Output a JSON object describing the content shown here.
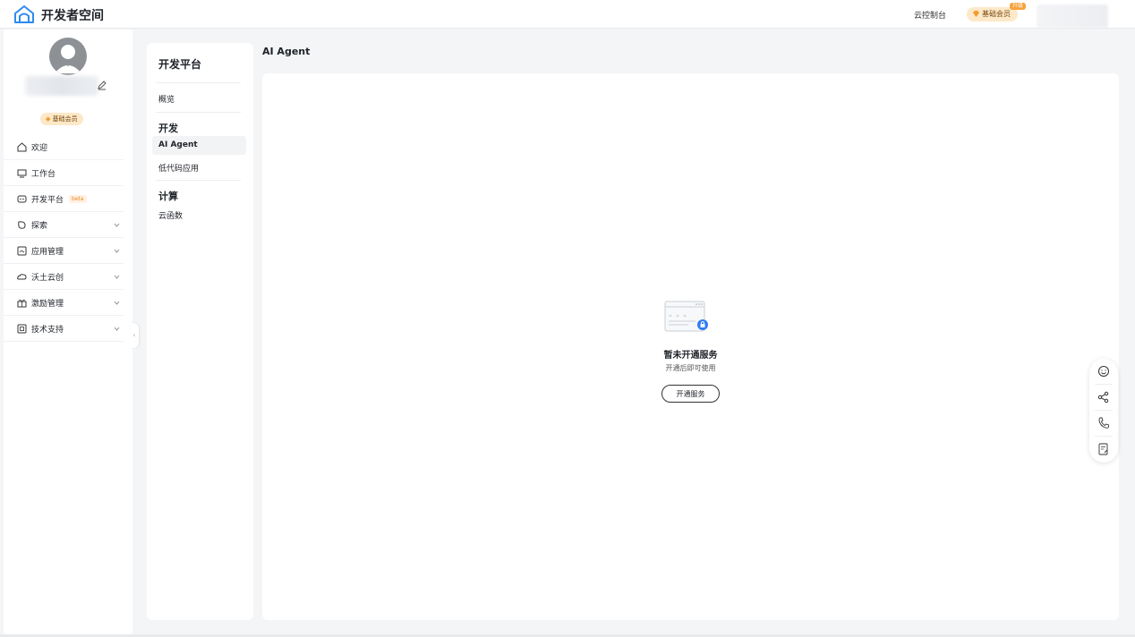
{
  "topbar": {
    "brand": "开发者空间",
    "console": "云控制台",
    "member": "基础会员",
    "upgrade": "升级"
  },
  "sidebar": {
    "member": "基础会员",
    "items": [
      {
        "label": "欢迎",
        "icon": "home-icon"
      },
      {
        "label": "工作台",
        "icon": "desktop-icon"
      },
      {
        "label": "开发平台",
        "icon": "robot-icon",
        "badge": "beta"
      },
      {
        "label": "探索",
        "icon": "explore-icon",
        "expandable": true
      },
      {
        "label": "应用管理",
        "icon": "app-icon",
        "expandable": true
      },
      {
        "label": "沃土云创",
        "icon": "cloud-icon",
        "expandable": true
      },
      {
        "label": "激励管理",
        "icon": "gift-icon",
        "expandable": true
      },
      {
        "label": "技术支持",
        "icon": "support-icon",
        "expandable": true
      }
    ],
    "collapse": "‹"
  },
  "subnav": {
    "title": "开发平台",
    "overview": "概览",
    "group_dev": "开发",
    "ai_agent": "AI Agent",
    "lowcode": "低代码应用",
    "group_compute": "计算",
    "cloud_function": "云函数"
  },
  "main": {
    "title": "AI Agent",
    "empty_title": "暂未开通服务",
    "empty_sub": "开通后即可使用",
    "open_button": "开通服务"
  },
  "colors": {
    "accent": "#1f6feb",
    "member_bg": "#fde8c8",
    "beta": "#f08a24"
  }
}
